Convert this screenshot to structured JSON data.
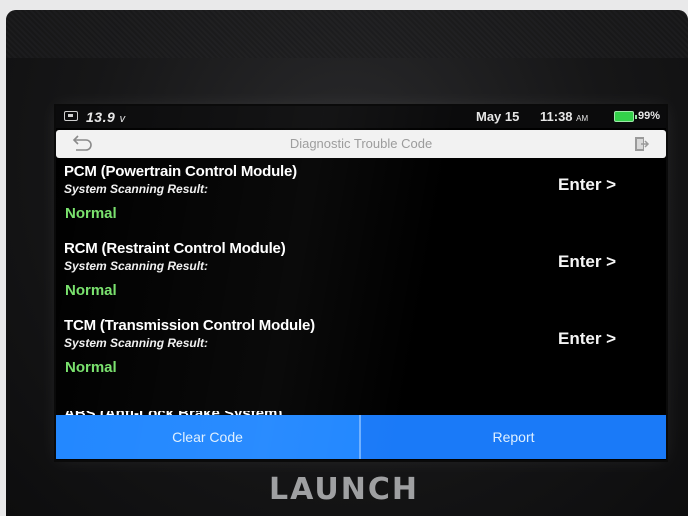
{
  "status_bar": {
    "voltage": "13.9",
    "voltage_unit": "v",
    "date": "May 15",
    "time": "11:38",
    "time_suffix": "AM",
    "battery_percent": "99%",
    "battery_color": "#33d14a"
  },
  "header": {
    "title": "Diagnostic Trouble Code",
    "back_icon": "back-arrow-icon",
    "exit_icon": "exit-icon"
  },
  "modules": [
    {
      "name": "PCM (Powertrain Control Module)",
      "subtitle": "System Scanning Result:",
      "status": "Normal",
      "action": "Enter >"
    },
    {
      "name": "RCM (Restraint Control Module)",
      "subtitle": "System Scanning Result:",
      "status": "Normal",
      "action": "Enter >"
    },
    {
      "name": "TCM (Transmission Control Module)",
      "subtitle": "System Scanning Result:",
      "status": "Normal",
      "action": "Enter >"
    }
  ],
  "partial_module": {
    "name": "ABS (Anti-Lock Brake System)"
  },
  "footer": {
    "clear_label": "Clear Code",
    "report_label": "Report",
    "accent_color": "#1c7eff"
  },
  "device": {
    "brand": "LAUNCH"
  },
  "colors": {
    "status_normal": "#79e26d"
  }
}
